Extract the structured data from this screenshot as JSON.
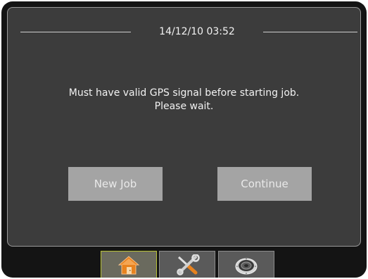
{
  "status_bar": {
    "datetime": "14/12/10 03:52"
  },
  "dialog": {
    "message_line1": "Must have valid GPS signal before starting job.",
    "message_line2": "Please wait."
  },
  "buttons": {
    "new_job_label": "New Job",
    "continue_label": "Continue"
  },
  "tabs": [
    {
      "icon": "home-icon",
      "active": true
    },
    {
      "icon": "tools-icon",
      "active": false
    },
    {
      "icon": "gps-antenna-icon",
      "active": false
    }
  ],
  "colors": {
    "screen_bg": "#3c3c3c",
    "bezel": "#141414",
    "button_bg": "#a4a4a4",
    "active_tab_border": "#b8c236",
    "home_icon_orange": "#e8821e"
  }
}
